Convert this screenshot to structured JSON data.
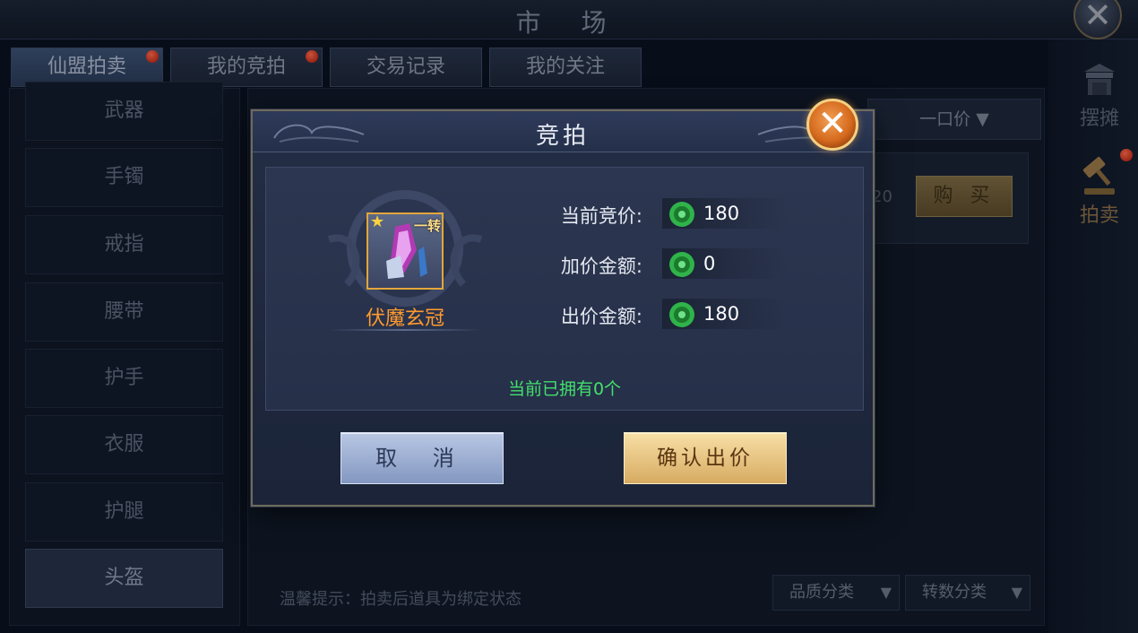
{
  "window": {
    "title": "市 场",
    "close_icon": "close-icon"
  },
  "tabs": [
    {
      "label": "仙盟拍卖",
      "active": true,
      "badge": true
    },
    {
      "label": "我的竞拍",
      "active": false,
      "badge": true
    },
    {
      "label": "交易记录",
      "active": false,
      "badge": false
    },
    {
      "label": "我的关注",
      "active": false,
      "badge": false
    }
  ],
  "categories": [
    {
      "label": "武器"
    },
    {
      "label": "手镯"
    },
    {
      "label": "戒指"
    },
    {
      "label": "腰带"
    },
    {
      "label": "护手"
    },
    {
      "label": "衣服"
    },
    {
      "label": "护腿"
    },
    {
      "label": "头盔",
      "active": true
    }
  ],
  "market": {
    "sort_label": "一口价",
    "item_price_fragment": "20",
    "buy_label": "购 买",
    "tip": "温馨提示：拍卖后道具为绑定状态",
    "filters": {
      "quality": "品质分类",
      "rebirth": "转数分类"
    }
  },
  "side": {
    "stall_label": "摆摊",
    "auction_label": "拍卖"
  },
  "dialog": {
    "title": "竞拍",
    "item": {
      "name": "伏魔玄冠",
      "tag": "一转",
      "star_icon": "star-icon"
    },
    "current_bid_label": "当前竞价:",
    "current_bid_value": "180",
    "increment_label": "加价金额:",
    "increment_value": "0",
    "offer_label": "出价金额:",
    "offer_value": "180",
    "owned_text": "当前已拥有0个",
    "cancel_label": "取 消",
    "confirm_label": "确认出价"
  },
  "colors": {
    "accent_gold": "#e3a63a",
    "item_name": "#ff9a2e",
    "owned_green": "#43e06c",
    "badge_red": "#d12a1a",
    "jade_coin": "#2fb34a"
  }
}
